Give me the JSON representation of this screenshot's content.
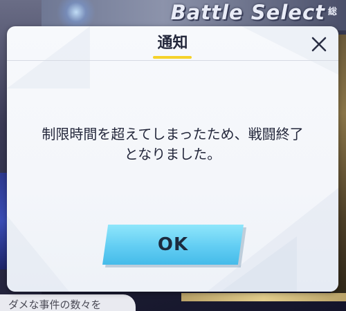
{
  "background": {
    "screen_title": "Battle Select",
    "corner_text": "総",
    "bottom_tab_text": "ダメな事件の数々を"
  },
  "dialog": {
    "title": "通知",
    "message_line1": "制限時間を超えてしまったため、戦闘終了",
    "message_line2": "となりました。",
    "ok_label": "OK",
    "close_icon": "close-icon"
  },
  "colors": {
    "title_underline": "#f5d22a",
    "ok_button": "#62cdf3",
    "text": "#23273b"
  }
}
